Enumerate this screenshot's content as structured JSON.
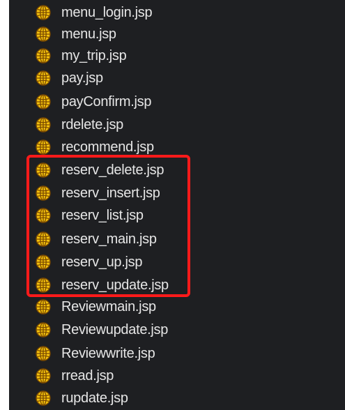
{
  "project_explorer": {
    "files": [
      {
        "name": "menu_login.jsp",
        "icon": "globe-icon"
      },
      {
        "name": "menu.jsp",
        "icon": "globe-icon"
      },
      {
        "name": "my_trip.jsp",
        "icon": "globe-icon"
      },
      {
        "name": "pay.jsp",
        "icon": "globe-icon"
      },
      {
        "name": "payConfirm.jsp",
        "icon": "globe-icon"
      },
      {
        "name": "rdelete.jsp",
        "icon": "globe-icon"
      },
      {
        "name": "recommend.jsp",
        "icon": "globe-icon"
      },
      {
        "name": "reserv_delete.jsp",
        "icon": "globe-icon"
      },
      {
        "name": "reserv_insert.jsp",
        "icon": "globe-icon"
      },
      {
        "name": "reserv_list.jsp",
        "icon": "globe-icon"
      },
      {
        "name": "reserv_main.jsp",
        "icon": "globe-icon"
      },
      {
        "name": "reserv_up.jsp",
        "icon": "globe-icon"
      },
      {
        "name": "reserv_update.jsp",
        "icon": "globe-icon"
      },
      {
        "name": "Reviewmain.jsp",
        "icon": "globe-icon"
      },
      {
        "name": "Reviewupdate.jsp",
        "icon": "globe-icon"
      },
      {
        "name": "Reviewwrite.jsp",
        "icon": "globe-icon"
      },
      {
        "name": "rread.jsp",
        "icon": "globe-icon"
      },
      {
        "name": "rupdate.jsp",
        "icon": "globe-icon"
      }
    ]
  },
  "colors": {
    "background": "#1e1f22",
    "text": "#e6e6e6",
    "icon_fill": "#f4c20d",
    "icon_stroke": "#7a4a00",
    "highlight": "#ff1a1a"
  }
}
